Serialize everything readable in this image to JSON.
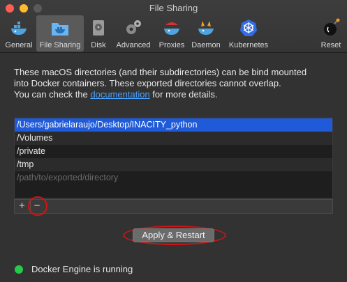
{
  "window": {
    "title": "File Sharing"
  },
  "tabs": [
    {
      "label": "General",
      "icon": "whale-icon"
    },
    {
      "label": "File Sharing",
      "icon": "folder-whale-icon"
    },
    {
      "label": "Disk",
      "icon": "disk-icon"
    },
    {
      "label": "Advanced",
      "icon": "gears-icon"
    },
    {
      "label": "Proxies",
      "icon": "proxy-whale-icon"
    },
    {
      "label": "Daemon",
      "icon": "daemon-whale-icon"
    },
    {
      "label": "Kubernetes",
      "icon": "kubernetes-icon"
    }
  ],
  "reset": {
    "label": "Reset",
    "icon": "bomb-icon"
  },
  "description": {
    "line1": "These macOS directories (and their subdirectories) can be bind mounted",
    "line2": "into Docker containers. These exported directories cannot overlap.",
    "line3_pre": "You can check the ",
    "link": "documentation",
    "line3_post": " for more details."
  },
  "directories": [
    "/Users/gabrielaraujo/Desktop/INACITY_python",
    "/Volumes",
    "/private",
    "/tmp"
  ],
  "placeholder": "/path/to/exported/directory",
  "list_controls": {
    "add": "+",
    "remove": "−"
  },
  "apply_button": "Apply & Restart",
  "status": {
    "text": "Docker Engine is running",
    "color": "#26c94a"
  },
  "colors": {
    "selection": "#1f5ad8",
    "link": "#4aa3ff",
    "annotation": "#d01414"
  }
}
